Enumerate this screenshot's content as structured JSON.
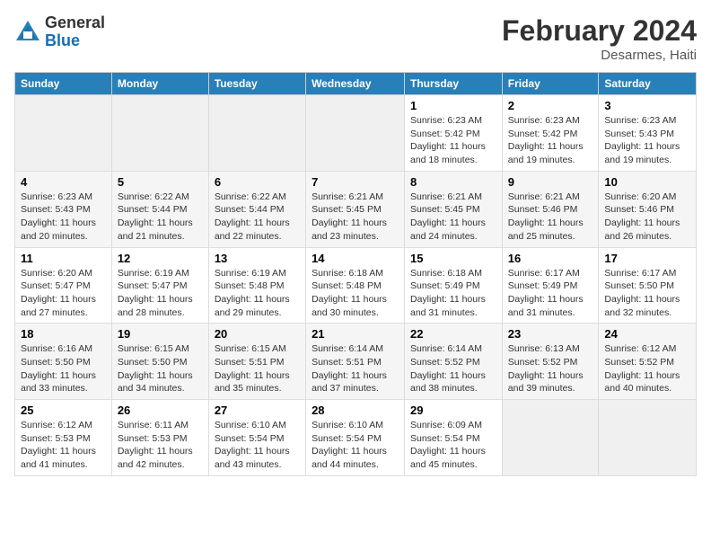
{
  "logo": {
    "general": "General",
    "blue": "Blue"
  },
  "title": "February 2024",
  "location": "Desarmes, Haiti",
  "days_of_week": [
    "Sunday",
    "Monday",
    "Tuesday",
    "Wednesday",
    "Thursday",
    "Friday",
    "Saturday"
  ],
  "weeks": [
    [
      {
        "day": "",
        "sunrise": "",
        "sunset": "",
        "daylight": "",
        "empty": true
      },
      {
        "day": "",
        "sunrise": "",
        "sunset": "",
        "daylight": "",
        "empty": true
      },
      {
        "day": "",
        "sunrise": "",
        "sunset": "",
        "daylight": "",
        "empty": true
      },
      {
        "day": "",
        "sunrise": "",
        "sunset": "",
        "daylight": "",
        "empty": true
      },
      {
        "day": "1",
        "sunrise": "Sunrise: 6:23 AM",
        "sunset": "Sunset: 5:42 PM",
        "daylight": "Daylight: 11 hours and 18 minutes."
      },
      {
        "day": "2",
        "sunrise": "Sunrise: 6:23 AM",
        "sunset": "Sunset: 5:42 PM",
        "daylight": "Daylight: 11 hours and 19 minutes."
      },
      {
        "day": "3",
        "sunrise": "Sunrise: 6:23 AM",
        "sunset": "Sunset: 5:43 PM",
        "daylight": "Daylight: 11 hours and 19 minutes."
      }
    ],
    [
      {
        "day": "4",
        "sunrise": "Sunrise: 6:23 AM",
        "sunset": "Sunset: 5:43 PM",
        "daylight": "Daylight: 11 hours and 20 minutes."
      },
      {
        "day": "5",
        "sunrise": "Sunrise: 6:22 AM",
        "sunset": "Sunset: 5:44 PM",
        "daylight": "Daylight: 11 hours and 21 minutes."
      },
      {
        "day": "6",
        "sunrise": "Sunrise: 6:22 AM",
        "sunset": "Sunset: 5:44 PM",
        "daylight": "Daylight: 11 hours and 22 minutes."
      },
      {
        "day": "7",
        "sunrise": "Sunrise: 6:21 AM",
        "sunset": "Sunset: 5:45 PM",
        "daylight": "Daylight: 11 hours and 23 minutes."
      },
      {
        "day": "8",
        "sunrise": "Sunrise: 6:21 AM",
        "sunset": "Sunset: 5:45 PM",
        "daylight": "Daylight: 11 hours and 24 minutes."
      },
      {
        "day": "9",
        "sunrise": "Sunrise: 6:21 AM",
        "sunset": "Sunset: 5:46 PM",
        "daylight": "Daylight: 11 hours and 25 minutes."
      },
      {
        "day": "10",
        "sunrise": "Sunrise: 6:20 AM",
        "sunset": "Sunset: 5:46 PM",
        "daylight": "Daylight: 11 hours and 26 minutes."
      }
    ],
    [
      {
        "day": "11",
        "sunrise": "Sunrise: 6:20 AM",
        "sunset": "Sunset: 5:47 PM",
        "daylight": "Daylight: 11 hours and 27 minutes."
      },
      {
        "day": "12",
        "sunrise": "Sunrise: 6:19 AM",
        "sunset": "Sunset: 5:47 PM",
        "daylight": "Daylight: 11 hours and 28 minutes."
      },
      {
        "day": "13",
        "sunrise": "Sunrise: 6:19 AM",
        "sunset": "Sunset: 5:48 PM",
        "daylight": "Daylight: 11 hours and 29 minutes."
      },
      {
        "day": "14",
        "sunrise": "Sunrise: 6:18 AM",
        "sunset": "Sunset: 5:48 PM",
        "daylight": "Daylight: 11 hours and 30 minutes."
      },
      {
        "day": "15",
        "sunrise": "Sunrise: 6:18 AM",
        "sunset": "Sunset: 5:49 PM",
        "daylight": "Daylight: 11 hours and 31 minutes."
      },
      {
        "day": "16",
        "sunrise": "Sunrise: 6:17 AM",
        "sunset": "Sunset: 5:49 PM",
        "daylight": "Daylight: 11 hours and 31 minutes."
      },
      {
        "day": "17",
        "sunrise": "Sunrise: 6:17 AM",
        "sunset": "Sunset: 5:50 PM",
        "daylight": "Daylight: 11 hours and 32 minutes."
      }
    ],
    [
      {
        "day": "18",
        "sunrise": "Sunrise: 6:16 AM",
        "sunset": "Sunset: 5:50 PM",
        "daylight": "Daylight: 11 hours and 33 minutes."
      },
      {
        "day": "19",
        "sunrise": "Sunrise: 6:15 AM",
        "sunset": "Sunset: 5:50 PM",
        "daylight": "Daylight: 11 hours and 34 minutes."
      },
      {
        "day": "20",
        "sunrise": "Sunrise: 6:15 AM",
        "sunset": "Sunset: 5:51 PM",
        "daylight": "Daylight: 11 hours and 35 minutes."
      },
      {
        "day": "21",
        "sunrise": "Sunrise: 6:14 AM",
        "sunset": "Sunset: 5:51 PM",
        "daylight": "Daylight: 11 hours and 37 minutes."
      },
      {
        "day": "22",
        "sunrise": "Sunrise: 6:14 AM",
        "sunset": "Sunset: 5:52 PM",
        "daylight": "Daylight: 11 hours and 38 minutes."
      },
      {
        "day": "23",
        "sunrise": "Sunrise: 6:13 AM",
        "sunset": "Sunset: 5:52 PM",
        "daylight": "Daylight: 11 hours and 39 minutes."
      },
      {
        "day": "24",
        "sunrise": "Sunrise: 6:12 AM",
        "sunset": "Sunset: 5:52 PM",
        "daylight": "Daylight: 11 hours and 40 minutes."
      }
    ],
    [
      {
        "day": "25",
        "sunrise": "Sunrise: 6:12 AM",
        "sunset": "Sunset: 5:53 PM",
        "daylight": "Daylight: 11 hours and 41 minutes."
      },
      {
        "day": "26",
        "sunrise": "Sunrise: 6:11 AM",
        "sunset": "Sunset: 5:53 PM",
        "daylight": "Daylight: 11 hours and 42 minutes."
      },
      {
        "day": "27",
        "sunrise": "Sunrise: 6:10 AM",
        "sunset": "Sunset: 5:54 PM",
        "daylight": "Daylight: 11 hours and 43 minutes."
      },
      {
        "day": "28",
        "sunrise": "Sunrise: 6:10 AM",
        "sunset": "Sunset: 5:54 PM",
        "daylight": "Daylight: 11 hours and 44 minutes."
      },
      {
        "day": "29",
        "sunrise": "Sunrise: 6:09 AM",
        "sunset": "Sunset: 5:54 PM",
        "daylight": "Daylight: 11 hours and 45 minutes."
      },
      {
        "day": "",
        "sunrise": "",
        "sunset": "",
        "daylight": "",
        "empty": true
      },
      {
        "day": "",
        "sunrise": "",
        "sunset": "",
        "daylight": "",
        "empty": true
      }
    ]
  ]
}
